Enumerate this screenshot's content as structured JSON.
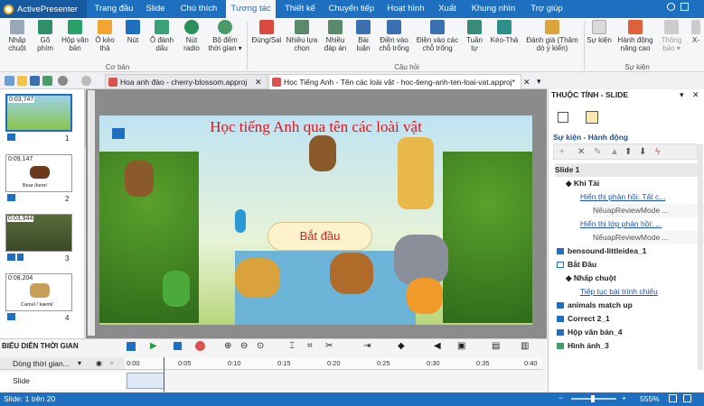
{
  "app": {
    "name": "ActivePresenter"
  },
  "menu_tabs": [
    "Trang đầu",
    "Slide",
    "Chú thích",
    "Tương tác",
    "Thiết kế",
    "Chuyển tiếp",
    "Hoạt hình",
    "Xuất",
    "Khung nhìn",
    "Trợ giúp"
  ],
  "active_tab_index": 3,
  "ribbon": {
    "buttons": [
      "Nhấp chuột",
      "Gõ phím",
      "Hộp văn bản",
      "Ô kéo thả",
      "Nút",
      "Ô đánh dấu",
      "Nút radio",
      "Bộ đếm thời gian ▾",
      "Đúng/Sai",
      "Nhiều lựa chọn",
      "Nhiều đáp án",
      "Bài luận",
      "Điền vào chỗ trống",
      "Điền vào các chỗ trống",
      "Tuần tự",
      "Kéo-Thả",
      "Đánh giá (Thăm dò ý kiến)",
      "Sự kiện",
      "Hành động nâng cao",
      "Thông báo ▾",
      "X-"
    ],
    "groups": [
      "Cơ bản",
      "Câu hỏi",
      "Sự kiện"
    ]
  },
  "doc_tabs": [
    "Hoa anh đào - cherry-blossom.approj",
    "Học Tiếng Anh - Tên các loài vật - hoc-tieng-anh-ten-loai-vat.approj*"
  ],
  "slides": [
    {
      "time": "0:03,747",
      "num": "1",
      "caption": ""
    },
    {
      "time": "0:09,147",
      "num": "2",
      "caption": "Bear /beər/"
    },
    {
      "time": "0:03,944",
      "num": "3",
      "caption": ""
    },
    {
      "time": "0:08,204",
      "num": "4",
      "caption": "Camel /ˈkæml/"
    }
  ],
  "slide_content": {
    "title": "Học tiếng Anh qua tên các loài vật",
    "start_button": "Bắt đầu"
  },
  "properties": {
    "header": "THUỘC TÍNH - SLIDE",
    "section": "Sự kiện - Hành động",
    "rows": [
      {
        "text": "Slide 1",
        "indent": 0,
        "style": "bold"
      },
      {
        "text": "◆ Khi Tải",
        "indent": 1,
        "style": "normal"
      },
      {
        "text": "Hiển thị phản hồi: Tất c...",
        "indent": 2,
        "style": "link"
      },
      {
        "text": "NếuapReviewMode ...",
        "indent": 3,
        "style": "muted"
      },
      {
        "text": "Hiển thị lớp phản hồi: ...",
        "indent": 2,
        "style": "link"
      },
      {
        "text": "NếuapReviewMode ...",
        "indent": 3,
        "style": "muted"
      },
      {
        "text": "bensound-littleidea_1",
        "indent": 0,
        "style": "bold"
      },
      {
        "text": "Bắt Đầu",
        "indent": 0,
        "style": "bold"
      },
      {
        "text": "◆ Nhấp chuột",
        "indent": 1,
        "style": "normal"
      },
      {
        "text": "Tiếp tục bài trình chiếu",
        "indent": 2,
        "style": "link"
      },
      {
        "text": "animals match up",
        "indent": 0,
        "style": "bold"
      },
      {
        "text": "Correct 2_1",
        "indent": 0,
        "style": "bold"
      },
      {
        "text": "Hộp văn bản_4",
        "indent": 0,
        "style": "bold"
      },
      {
        "text": "Hình ảnh_3",
        "indent": 0,
        "style": "bold"
      }
    ]
  },
  "timeline": {
    "title": "BIỂU DIỄN THỜI GIAN",
    "row_header": "Dòng thời gian...",
    "row": "Slide",
    "ticks": [
      "0:00",
      "0:05",
      "0:10",
      "0:15",
      "0:20",
      "0:25",
      "0:30",
      "0:35",
      "0:40"
    ]
  },
  "status": {
    "slide": "Slide: 1 trên 20",
    "zoom": "555%"
  }
}
